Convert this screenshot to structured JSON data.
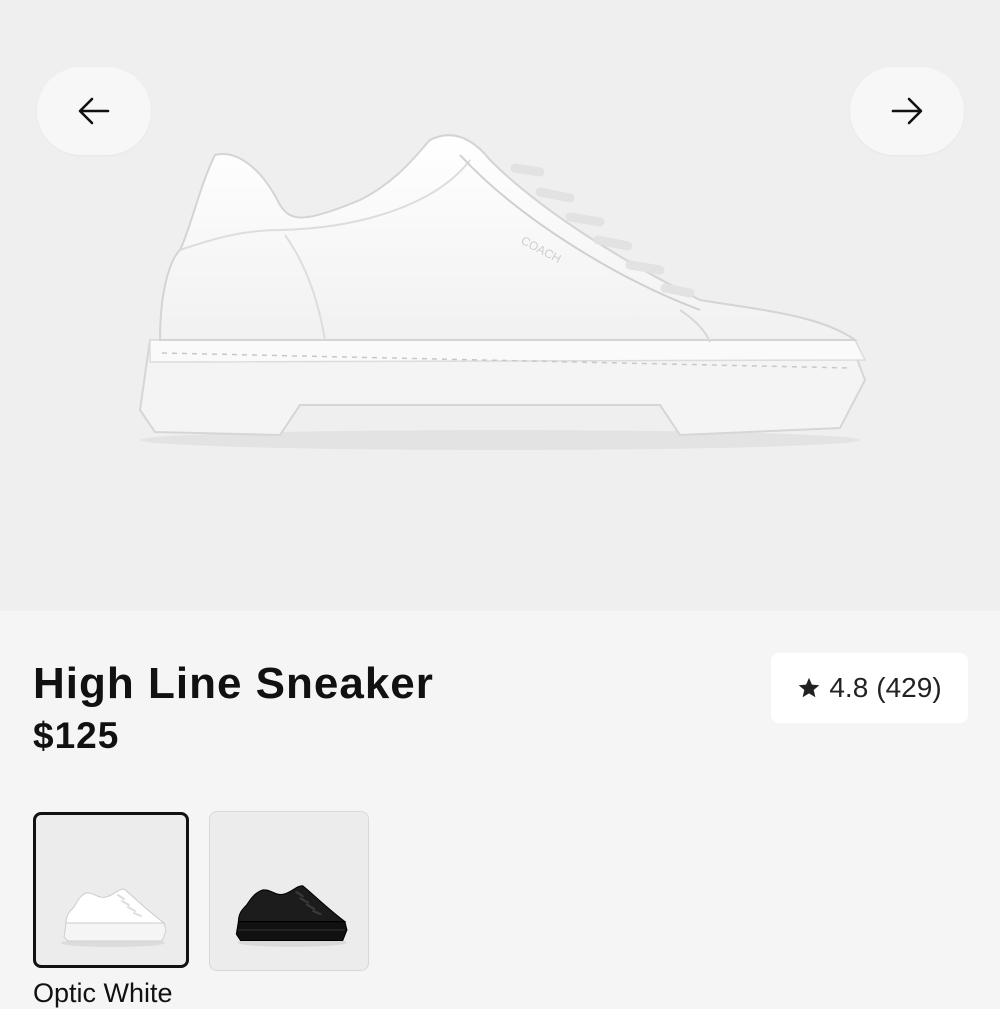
{
  "gallery": {
    "prev_icon": "arrow-left-icon",
    "next_icon": "arrow-right-icon",
    "image_alt": "white leather low-top sneaker",
    "logo_text": "COACH"
  },
  "product": {
    "title": "High Line Sneaker",
    "price": "$125",
    "rating": {
      "icon": "star-icon",
      "value": "4.8",
      "count": "(429)"
    }
  },
  "colors": {
    "swatches": [
      {
        "name": "Optic White",
        "selected": true
      },
      {
        "name": "Black",
        "selected": false
      }
    ],
    "selected_label": "Optic White"
  },
  "theme": {
    "gallery_bg": "#efefef",
    "page_bg": "#f5f5f5",
    "text": "#111111",
    "selected_border": "#111111"
  }
}
